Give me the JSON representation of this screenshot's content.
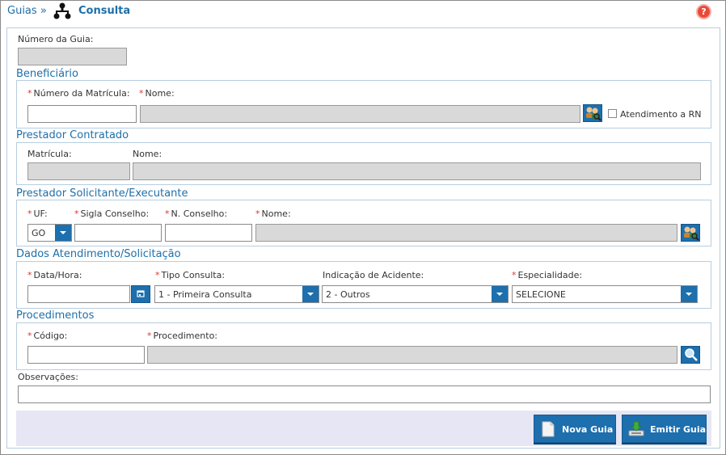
{
  "header": {
    "breadcrumb_link": "Guias",
    "breadcrumb_sep": "»",
    "title": "Consulta",
    "help_icon_glyph": "?"
  },
  "form": {
    "numero_guia": {
      "label": "Número da Guia:",
      "value": ""
    },
    "beneficiario": {
      "title": "Beneficiário",
      "matricula_label": "Número da Matrícula:",
      "nome_label": "Nome:",
      "matricula_value": "",
      "nome_value": "",
      "rn_label": "Atendimento a RN",
      "rn_checked": false
    },
    "prestador_contratado": {
      "title": "Prestador Contratado",
      "matricula_label": "Matrícula:",
      "nome_label": "Nome:"
    },
    "prestador_solicitante": {
      "title": "Prestador Solicitante/Executante",
      "uf_label": "UF:",
      "uf_value": "GO",
      "sigla_label": "Sigla Conselho:",
      "nconselho_label": "N. Conselho:",
      "nome_label": "Nome:"
    },
    "dados_atendimento": {
      "title": "Dados Atendimento/Solicitação",
      "data_label": "Data/Hora:",
      "tipo_label": "Tipo Consulta:",
      "tipo_value": "1 - Primeira Consulta",
      "acidente_label": "Indicação de Acidente:",
      "acidente_value": "2 - Outros",
      "especialidade_label": "Especialidade:",
      "especialidade_value": "SELECIONE"
    },
    "procedimentos": {
      "title": "Procedimentos",
      "codigo_label": "Código:",
      "procedimento_label": "Procedimento:"
    },
    "observacoes": {
      "label": "Observações:",
      "value": ""
    }
  },
  "actions": {
    "nova_guia": "Nova Guia",
    "emitir_guia": "Emitir Guia"
  },
  "required_marker": "*",
  "colors": {
    "accent": "#1d6fae",
    "title_blue": "#1f6fa8",
    "required_red": "#e0352b",
    "readonly_gray": "#d9d9d9",
    "toolbar_bg": "#e6e6f5"
  }
}
